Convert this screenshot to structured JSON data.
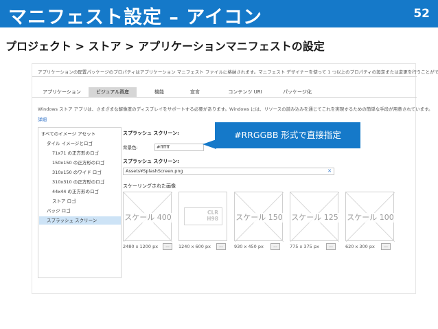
{
  "slide": {
    "title": "マニフェスト設定 – アイコン",
    "page_number": "52",
    "subtitle": "プロジェクト > ストア > アプリケーションマニフェストの設定",
    "title_bar_color": "#1579c9"
  },
  "manifest": {
    "description": "アプリケーションの配置パッケージのプロパティはアプリケーション マニフェスト ファイルに格納されます。マニフェスト デザイナーを使って 1 つ以上のプロパティの設定または変更を行うことができます。",
    "tabs": [
      {
        "label": "アプリケーション",
        "active": false
      },
      {
        "label": "ビジュアル資産",
        "active": true
      },
      {
        "label": "機能",
        "active": false
      },
      {
        "label": "宣言",
        "active": false
      },
      {
        "label": "コンテンツ URI",
        "active": false
      },
      {
        "label": "パッケージ化",
        "active": false
      }
    ],
    "info_text": "Windows ストア アプリは、さまざまな解像度のディスプレイをサポートする必要があります。Windows には、リソースの読み込みを通じてこれを実現するための簡単な手段が用意されています。",
    "details_link": "詳細",
    "tree": [
      {
        "label": "すべてのイメージ アセット",
        "selected": false
      },
      {
        "label": "タイル イメージとロゴ",
        "selected": false
      },
      {
        "label": "71x71 の正方形のロゴ",
        "selected": false
      },
      {
        "label": "150x150 の正方形のロゴ",
        "selected": false
      },
      {
        "label": "310x150 のワイド ロゴ",
        "selected": false
      },
      {
        "label": "310x310 の正方形のロゴ",
        "selected": false
      },
      {
        "label": "44x44 の正方形のロゴ",
        "selected": false
      },
      {
        "label": "ストア ロゴ",
        "selected": false
      },
      {
        "label": "バッジ ロゴ",
        "selected": false
      },
      {
        "label": "スプラッシュ スクリーン",
        "selected": true
      }
    ],
    "splash_heading_1": "スプラッシュ スクリーン:",
    "bg_label": "背景色:",
    "bg_value": "#ffffff",
    "splash_heading_2": "スプラッシュ スクリーン:",
    "splash_path": "Assets¥SplashScreen.png",
    "path_clear": "✕",
    "scaled_heading": "スケーリングされた画像",
    "thumbs": [
      {
        "label": "スケール 400",
        "size": "2480 x 1200 px"
      },
      {
        "label": "",
        "size": "1240 x 600 px",
        "overlay": "CLR\nH98"
      },
      {
        "label": "スケール 150",
        "size": "930 x 450 px"
      },
      {
        "label": "スケール 125",
        "size": "775 x 375 px"
      },
      {
        "label": "スケール 100",
        "size": "620 x 300 px"
      }
    ],
    "browse_label": "..."
  },
  "callout": {
    "text": "#RRGGBB 形式で直接指定",
    "color": "#1579c9"
  }
}
